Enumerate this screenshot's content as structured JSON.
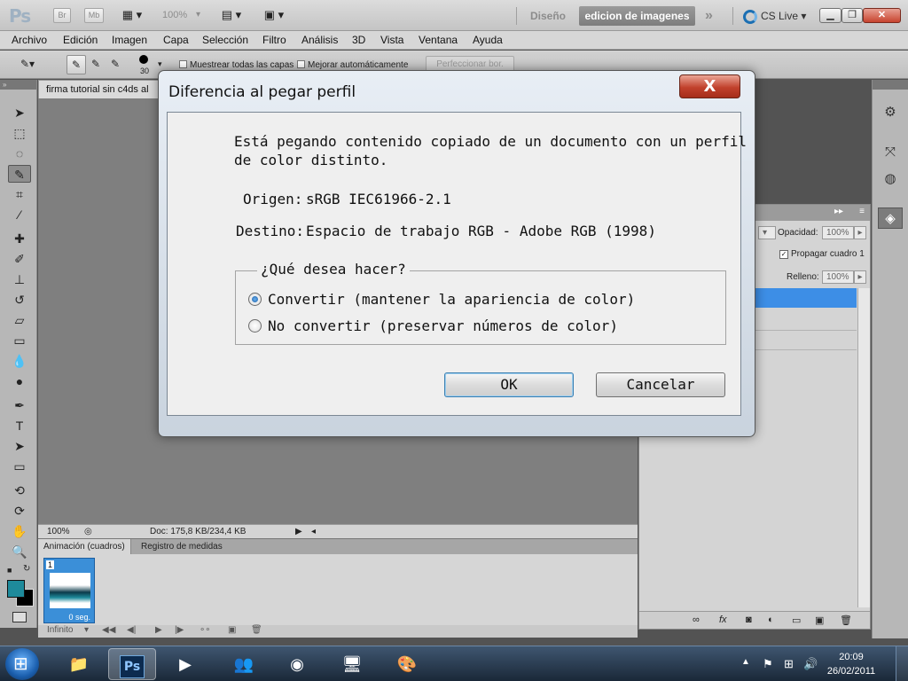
{
  "appbar": {
    "logo": "Ps",
    "bridge": "Br",
    "minibridge": "Mb",
    "zoom": "100%",
    "workspaces": {
      "design": "Diseño",
      "active": "edicion de imagenes",
      "more": "»"
    },
    "cs_live": "CS Live"
  },
  "menu": [
    "Archivo",
    "Edición",
    "Imagen",
    "Capa",
    "Selección",
    "Filtro",
    "Análisis",
    "3D",
    "Vista",
    "Ventana",
    "Ayuda"
  ],
  "options": {
    "brush_size": "30",
    "sample_all_layers": "Muestrear todas las capas",
    "auto_enhance": "Mejorar automáticamente",
    "refine_edge": "Perfeccionar bor."
  },
  "document": {
    "tab_title": "firma tutorial sin c4ds al",
    "zoom": "100%",
    "doc_info": "Doc: 175,8 KB/234,4 KB"
  },
  "animation": {
    "tabs": [
      "Animación (cuadros)",
      "Registro de medidas"
    ],
    "frame_number": "1",
    "frame_duration": "0 seg.",
    "loop": "Infinito"
  },
  "layers": {
    "opacity_label": "Opacidad:",
    "opacity_value": "100%",
    "propagate": "Propagar cuadro 1",
    "fill_label": "Relleno:",
    "fill_value": "100%"
  },
  "dialog": {
    "title": "Diferencia al pegar perfil",
    "close": "X",
    "message_line1": "Está pegando contenido copiado de un documento con un perfil",
    "message_line2": "de color distinto.",
    "source_label": "Origen:",
    "source_value": "sRGB IEC61966-2.1",
    "dest_label": "Destino:",
    "dest_value": "Espacio de trabajo RGB - Adobe RGB (1998)",
    "question": "¿Qué desea hacer?",
    "option_convert": "Convertir (mantener la apariencia de color)",
    "option_no_convert": "No convertir (preservar números de color)",
    "ok": "OK",
    "cancel": "Cancelar"
  },
  "taskbar": {
    "time": "20:09",
    "date": "26/02/2011",
    "ps_label": "Ps"
  },
  "colors": {
    "foreground": "#1e8a9b",
    "background": "#000000",
    "layer_selected": "#3d8ee6"
  }
}
